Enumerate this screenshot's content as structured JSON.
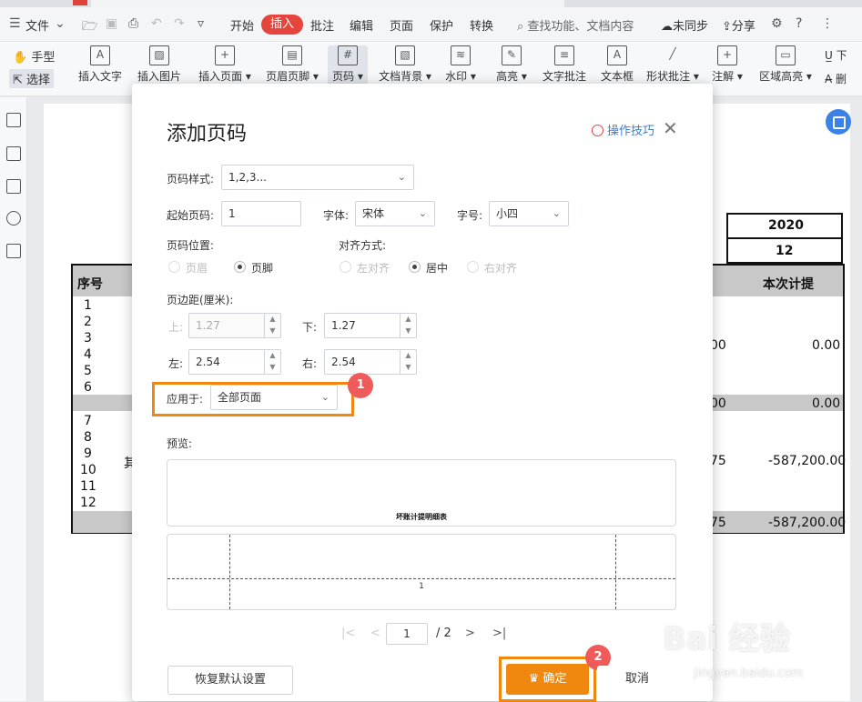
{
  "menubar": {
    "file": "文件",
    "tabs": [
      "开始",
      "插入",
      "批注",
      "编辑",
      "页面",
      "保护",
      "转换"
    ],
    "search": "查找功能、文档内容",
    "sync": "未同步",
    "share": "分享"
  },
  "ribbon": {
    "hand": "手型",
    "select": "选择",
    "tools": [
      {
        "label": "插入文字",
        "icon": "text-insert-icon"
      },
      {
        "label": "插入图片",
        "icon": "image-insert-icon"
      },
      {
        "label": "插入页面 ▾",
        "icon": "page-insert-icon"
      },
      {
        "label": "页眉页脚 ▾",
        "icon": "header-footer-icon"
      },
      {
        "label": "页码 ▾",
        "icon": "page-number-icon"
      },
      {
        "label": "文档背景 ▾",
        "icon": "background-icon"
      },
      {
        "label": "水印 ▾",
        "icon": "watermark-icon"
      },
      {
        "label": "高亮 ▾",
        "icon": "highlight-icon"
      },
      {
        "label": "文字批注",
        "icon": "text-comment-icon"
      },
      {
        "label": "文本框",
        "icon": "textbox-icon"
      },
      {
        "label": "形状批注 ▾",
        "icon": "shape-comment-icon"
      },
      {
        "label": "注解 ▾",
        "icon": "annotation-icon"
      },
      {
        "label": "区域高亮 ▾",
        "icon": "area-highlight-icon"
      },
      {
        "label": "下",
        "icon": "underline-icon"
      },
      {
        "label": "删",
        "icon": "strike-icon"
      }
    ]
  },
  "document": {
    "year": "2020",
    "month": "12",
    "col_seq": "序号",
    "col_current": "本次计提",
    "row_nums": [
      "1",
      "2",
      "3",
      "4",
      "5",
      "6",
      "7",
      "8",
      "9",
      "10",
      "11",
      "12"
    ],
    "partial_char": "其",
    "mid_vals": [
      "00",
      "00",
      "75",
      "75"
    ],
    "amounts": [
      "0.00",
      "0.00",
      "-587,200.00",
      "-587,200.00"
    ]
  },
  "dialog": {
    "title": "添加页码",
    "tips": "操作技巧",
    "style_label": "页码样式:",
    "style_value": "1,2,3...",
    "start_label": "起始页码:",
    "start_value": "1",
    "font_label": "字体:",
    "font_value": "宋体",
    "size_label": "字号:",
    "size_value": "小四",
    "position_label": "页码位置:",
    "pos_header": "页眉",
    "pos_footer": "页脚",
    "align_label": "对齐方式:",
    "align_left": "左对齐",
    "align_center": "居中",
    "align_right": "右对齐",
    "margin_label": "页边距(厘米):",
    "top_label": "上:",
    "top_value": "1.27",
    "bottom_label": "下:",
    "bottom_value": "1.27",
    "left_label": "左:",
    "left_value": "2.54",
    "right_label": "右:",
    "right_value": "2.54",
    "apply_label": "应用于:",
    "apply_value": "全部页面",
    "preview_label": "预览:",
    "preview_title": "坏账计提明细表",
    "preview_page_num": "1",
    "page_current": "1",
    "page_total": "/ 2",
    "reset": "恢复默认设置",
    "ok": "确定",
    "cancel": "取消",
    "badge1": "1",
    "badge2": "2"
  },
  "watermark": {
    "main": "Bai 经验",
    "sub": "jingyan.baidu.com"
  },
  "colors": {
    "accent": "#f0870f",
    "active_tab": "#e5453c",
    "link": "#3a7bd5",
    "badge": "#ef5b5b"
  }
}
